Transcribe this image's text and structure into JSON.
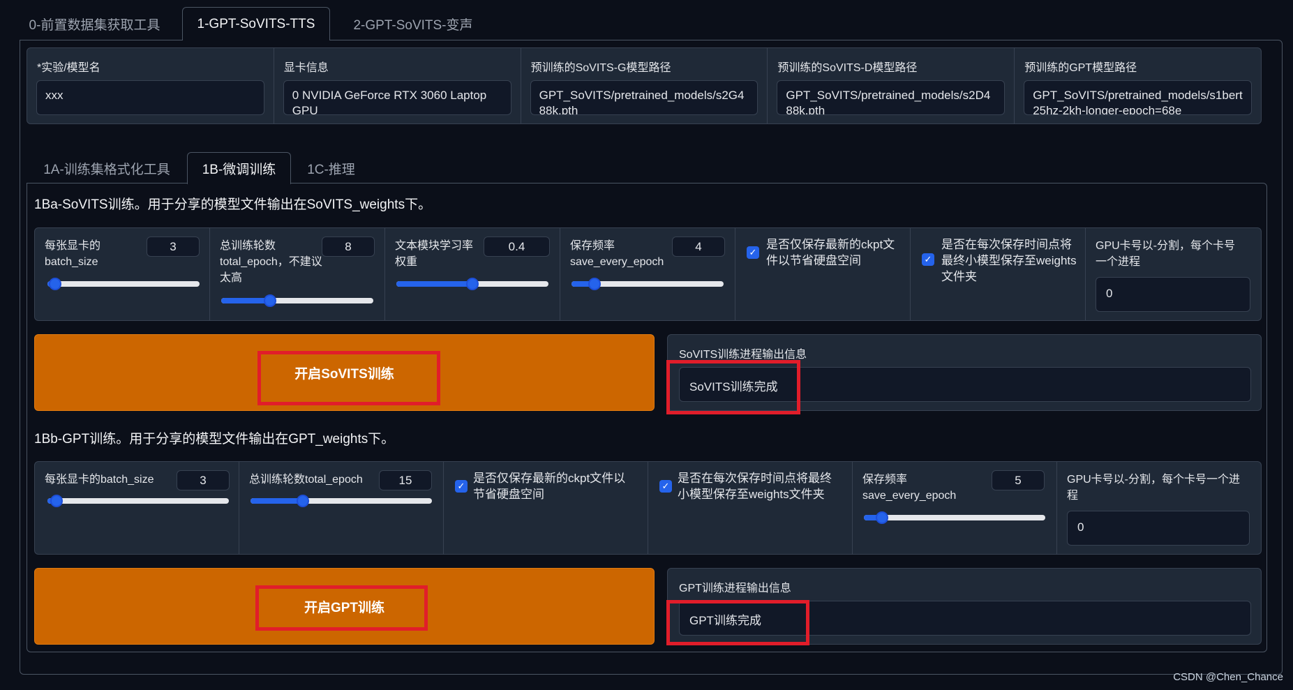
{
  "top_tabs": [
    "0-前置数据集获取工具",
    "1-GPT-SoVITS-TTS",
    "2-GPT-SoVITS-变声"
  ],
  "info": [
    {
      "label": "*实验/模型名",
      "value": "xxx"
    },
    {
      "label": "显卡信息",
      "value": "0  NVIDIA GeForce RTX 3060 Laptop GPU"
    },
    {
      "label": "预训练的SoVITS-G模型路径",
      "value": "GPT_SoVITS/pretrained_models/s2G488k.pth"
    },
    {
      "label": "预训练的SoVITS-D模型路径",
      "value": "GPT_SoVITS/pretrained_models/s2D488k.pth"
    },
    {
      "label": "预训练的GPT模型路径",
      "value": "GPT_SoVITS/pretrained_models/s1bert25hz-2kh-longer-epoch=68e"
    }
  ],
  "sub_tabs": [
    "1A-训练集格式化工具",
    "1B-微调训练",
    "1C-推理"
  ],
  "sovits": {
    "title": "1Ba-SoVITS训练。用于分享的模型文件输出在SoVITS_weights下。",
    "batch": {
      "label": "每张显卡的batch_size",
      "value": "3",
      "fraction": 0.05
    },
    "epoch": {
      "label": "总训练轮数total_epoch，不建议太高",
      "value": "8",
      "fraction": 0.32
    },
    "text_lr": {
      "label": "文本模块学习率权重",
      "value": "0.4",
      "fraction": 0.5
    },
    "save_freq": {
      "label": "保存频率save_every_epoch",
      "value": "4",
      "fraction": 0.15
    },
    "if_save_latest": {
      "label": "是否仅保存最新的ckpt文件以节省硬盘空间",
      "checked": true
    },
    "if_save_weights": {
      "label": "是否在每次保存时间点将最终小模型保存至weights文件夹",
      "checked": true
    },
    "gpu": {
      "label": "GPU卡号以-分割，每个卡号一个进程",
      "value": "0"
    },
    "button": "开启SoVITS训练",
    "output_label": "SoVITS训练进程输出信息",
    "output_value": "SoVITS训练完成"
  },
  "gpt": {
    "title": "1Bb-GPT训练。用于分享的模型文件输出在GPT_weights下。",
    "batch": {
      "label": "每张显卡的batch_size",
      "value": "3",
      "fraction": 0.05
    },
    "epoch": {
      "label": "总训练轮数total_epoch",
      "value": "15",
      "fraction": 0.29
    },
    "if_save_latest": {
      "label": "是否仅保存最新的ckpt文件以节省硬盘空间",
      "checked": true
    },
    "if_save_weights": {
      "label": "是否在每次保存时间点将最终小模型保存至weights文件夹",
      "checked": true
    },
    "save_freq": {
      "label": "保存频率save_every_epoch",
      "value": "5",
      "fraction": 0.1
    },
    "gpu": {
      "label": "GPU卡号以-分割，每个卡号一个进程",
      "value": "0"
    },
    "button": "开启GPT训练",
    "output_label": "GPT训练进程输出信息",
    "output_value": "GPT训练完成"
  },
  "watermark": "CSDN @Chen_Chance",
  "colors": {
    "accent": "#cc6600",
    "highlight": "#e11d2a",
    "slider": "#2563eb"
  }
}
